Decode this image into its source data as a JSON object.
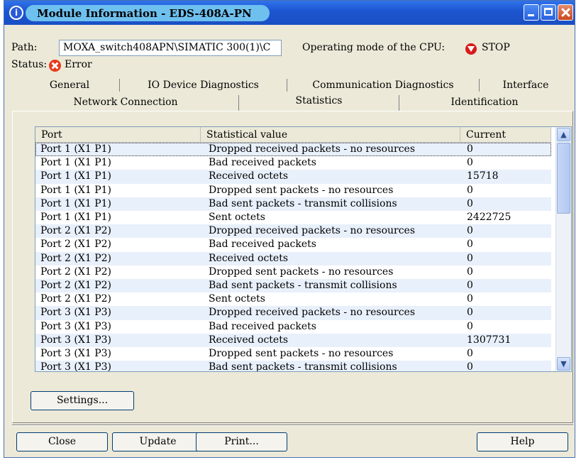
{
  "window": {
    "title": "Module Information - EDS-408A-PN",
    "icon_name": "info-icon"
  },
  "path": {
    "label": "Path:",
    "value": "MOXA_switch408APN\\SIMATIC 300(1)\\C"
  },
  "cpu_mode": {
    "label": "Operating mode of the  CPU:",
    "value": "STOP",
    "icon_name": "stop-icon"
  },
  "status": {
    "label": "Status:",
    "value": "Error",
    "icon_name": "error-icon"
  },
  "tabs": {
    "row1": [
      {
        "label": "General"
      },
      {
        "label": "IO Device Diagnostics"
      },
      {
        "label": "Communication Diagnostics"
      },
      {
        "label": "Interface"
      }
    ],
    "row2": [
      {
        "label": "Network Connection"
      },
      {
        "label": "Statistics",
        "selected": true
      },
      {
        "label": "Identification"
      }
    ]
  },
  "table": {
    "columns": [
      "Port",
      "Statistical value",
      "Current"
    ],
    "rows": [
      [
        "Port 1 (X1 P1)",
        "Dropped received packets - no resources",
        "0"
      ],
      [
        "Port 1 (X1 P1)",
        "Bad received packets",
        "0"
      ],
      [
        "Port 1 (X1 P1)",
        "Received octets",
        "15718"
      ],
      [
        "Port 1 (X1 P1)",
        "Dropped sent packets - no resources",
        "0"
      ],
      [
        "Port 1 (X1 P1)",
        "Bad sent packets - transmit collisions",
        "0"
      ],
      [
        "Port 1 (X1 P1)",
        "Sent octets",
        "2422725"
      ],
      [
        "Port 2 (X1 P2)",
        "Dropped received packets - no resources",
        "0"
      ],
      [
        "Port 2 (X1 P2)",
        "Bad received packets",
        "0"
      ],
      [
        "Port 2 (X1 P2)",
        "Received octets",
        "0"
      ],
      [
        "Port 2 (X1 P2)",
        "Dropped sent packets - no resources",
        "0"
      ],
      [
        "Port 2 (X1 P2)",
        "Bad sent packets - transmit collisions",
        "0"
      ],
      [
        "Port 2 (X1 P2)",
        "Sent octets",
        "0"
      ],
      [
        "Port 3 (X1 P3)",
        "Dropped received packets - no resources",
        "0"
      ],
      [
        "Port 3 (X1 P3)",
        "Bad received packets",
        "0"
      ],
      [
        "Port 3 (X1 P3)",
        "Received octets",
        "1307731"
      ],
      [
        "Port 3 (X1 P3)",
        "Dropped sent packets - no resources",
        "0"
      ],
      [
        "Port 3 (X1 P3)",
        "Bad sent packets - transmit collisions",
        "0"
      ]
    ]
  },
  "buttons": {
    "settings": "Settings...",
    "close": "Close",
    "update": "Update",
    "print": "Print...",
    "help": "Help"
  },
  "colors": {
    "title_bar": "#1d55cf",
    "row_alt": "#e8f0fb",
    "error": "#e83a1a"
  }
}
